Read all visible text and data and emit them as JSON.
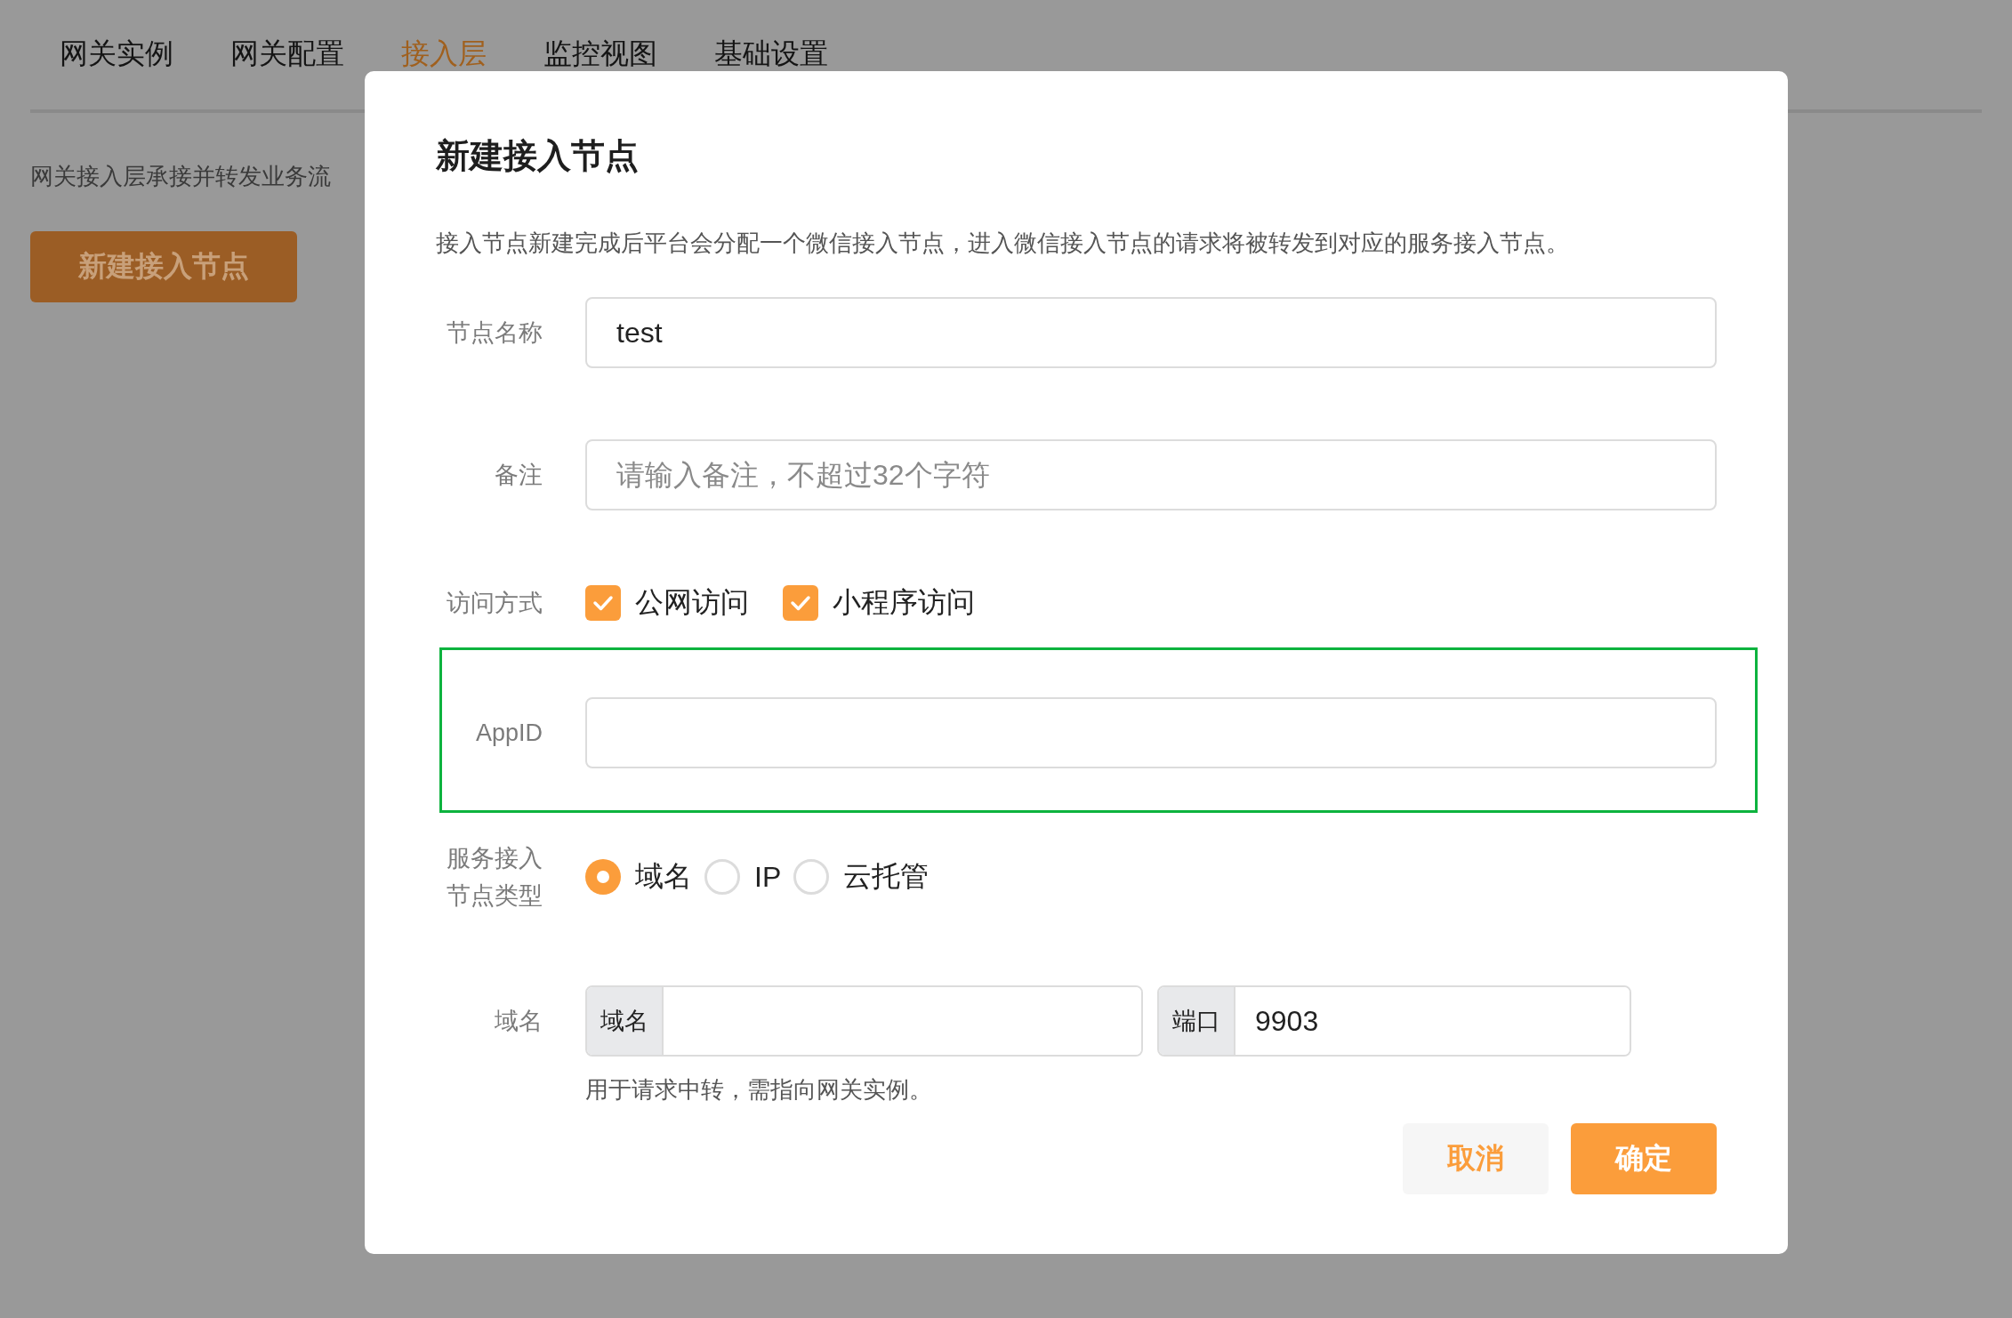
{
  "background": {
    "tabs": [
      {
        "label": "网关实例",
        "selected": false
      },
      {
        "label": "网关配置",
        "selected": false
      },
      {
        "label": "接入层",
        "selected": true
      },
      {
        "label": "监控视图",
        "selected": false
      },
      {
        "label": "基础设置",
        "selected": false
      }
    ],
    "description": "网关接入层承接并转发业务流",
    "new_button": "新建接入节点"
  },
  "dialog": {
    "title": "新建接入节点",
    "description": "接入节点新建完成后平台会分配一个微信接入节点，进入微信接入节点的请求将被转发到对应的服务接入节点。",
    "fields": [
      {
        "kind": "text",
        "label": "节点名称",
        "value": "test",
        "highlighted": false
      },
      {
        "kind": "text",
        "label": "备注",
        "placeholder": "请输入备注，不超过32个字符",
        "highlighted": false
      },
      {
        "kind": "checkboxes",
        "label": "访问方式",
        "options": [
          {
            "label": "公网访问",
            "checked": true
          },
          {
            "label": "小程序访问",
            "checked": true
          }
        ]
      },
      {
        "kind": "text",
        "label": "AppID",
        "highlighted": true
      },
      {
        "kind": "radios",
        "label": "服务接入节点类型",
        "options": [
          {
            "label": "域名",
            "selected": true
          },
          {
            "label": "IP",
            "selected": false
          },
          {
            "label": "云托管",
            "selected": false
          }
        ]
      },
      {
        "kind": "address",
        "label": "域名",
        "groups": [
          {
            "addon": "域名"
          },
          {
            "addon": "端口",
            "value": "9903"
          }
        ],
        "hint": "用于请求中转，需指向网关实例。"
      }
    ],
    "buttons": [
      {
        "label": "取消",
        "kind": "secondary"
      },
      {
        "label": "确定",
        "kind": "primary"
      }
    ]
  }
}
